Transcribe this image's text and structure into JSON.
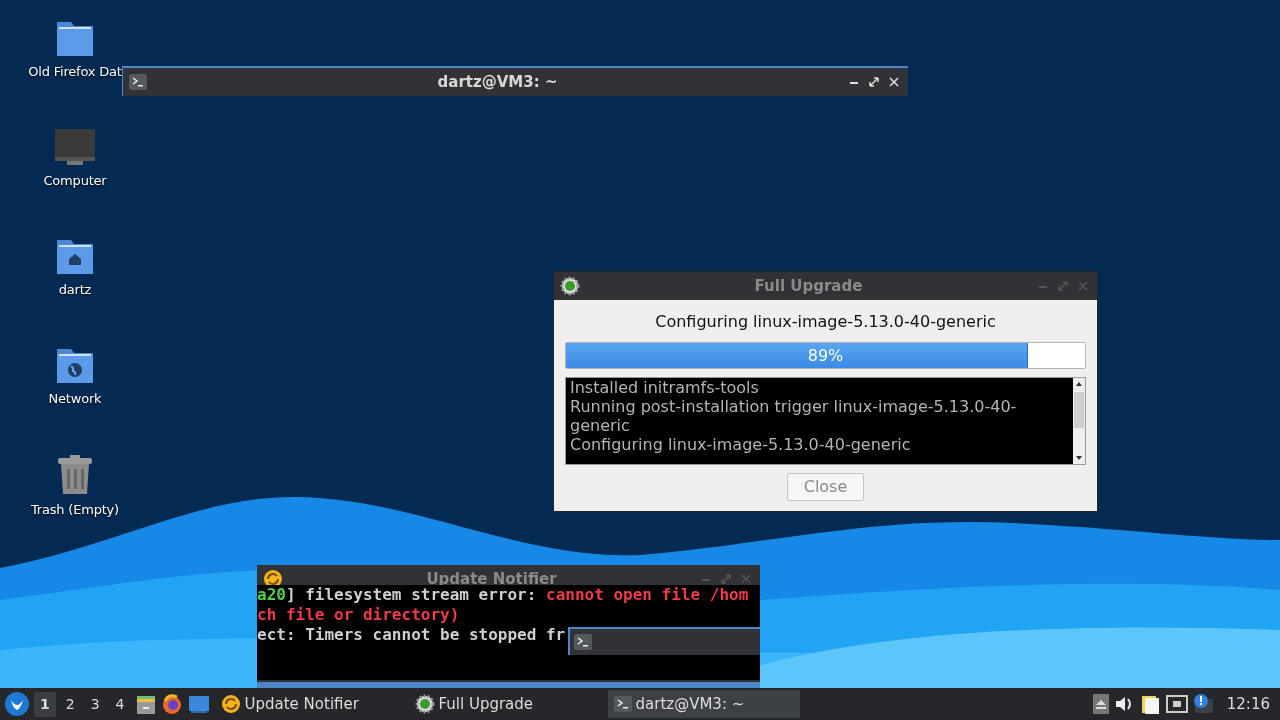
{
  "desktop_icons": [
    {
      "label": "Old Firefox Dat",
      "kind": "folder"
    },
    {
      "label": "Computer",
      "kind": "computer"
    },
    {
      "label": "dartz",
      "kind": "home"
    },
    {
      "label": "Network",
      "kind": "network"
    },
    {
      "label": "Trash (Empty)",
      "kind": "trash"
    }
  ],
  "terminal_window": {
    "title": "dartz@VM3: ~",
    "active": true
  },
  "upgrade_dialog": {
    "title": "Full Upgrade",
    "active": false,
    "status": "Configuring linux-image-5.13.0-40-generic",
    "progress": {
      "level": 0.89,
      "text": "89%"
    },
    "log": [
      "Installed initramfs-tools",
      "Running post-installation trigger linux-image-5.13.0-40-generic",
      "Configuring linux-image-5.13.0-40-generic"
    ],
    "close_button": {
      "label": "Close",
      "disabled": true
    }
  },
  "notifier_window": {
    "title": "Update Notifier",
    "active": false,
    "terminal_lines": [
      [
        {
          "text": "a20",
          "kind": "prompt"
        },
        {
          "text": "] filesystem stream error: ",
          "kind": "normal"
        },
        {
          "text": "cannot open file /hom",
          "kind": "error"
        }
      ],
      [
        {
          "text": "ch file or directory)",
          "kind": "error"
        }
      ],
      [
        {
          "text": "ect: Timers cannot be stopped fr",
          "kind": "normal"
        }
      ]
    ]
  },
  "taskbar": {
    "workspaces": [
      {
        "label": "1",
        "selected": true
      },
      {
        "label": "2",
        "selected": false
      },
      {
        "label": "3",
        "selected": false
      },
      {
        "label": "4",
        "selected": false
      }
    ],
    "tasks": [
      {
        "label": "Update Notifier",
        "kind": "notifier",
        "selected": false
      },
      {
        "label": "Full Upgrade",
        "kind": "upgrade",
        "selected": false
      },
      {
        "label": "dartz@VM3: ~",
        "kind": "terminal",
        "selected": true
      }
    ],
    "clock": "12:16"
  }
}
